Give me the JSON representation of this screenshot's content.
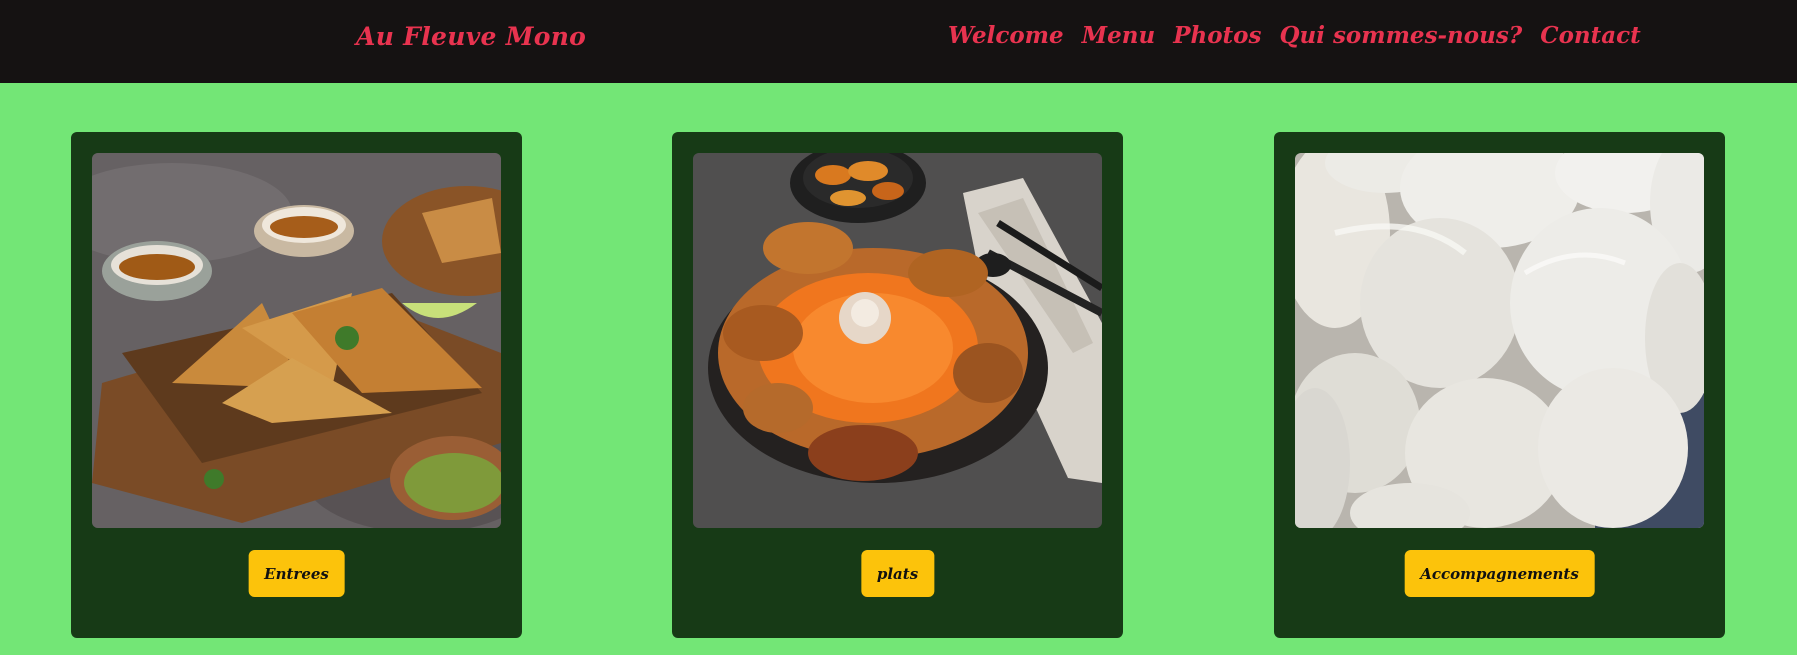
{
  "header": {
    "brand": "Au Fleuve Mono",
    "nav": [
      "Welcome",
      "Menu",
      "Photos",
      "Qui sommes-nous?",
      "Contact"
    ]
  },
  "cards": [
    {
      "button_label": "Entrees",
      "image": "samosas-photo"
    },
    {
      "button_label": "plats",
      "image": "jollof-rice-chicken-photo"
    },
    {
      "button_label": "Accompagnements",
      "image": "fufu-balls-photo"
    }
  ],
  "colors": {
    "background": "#73e676",
    "header": "#151212",
    "card": "#173a16",
    "accent_text": "#e8334f",
    "button": "#fcc30b"
  }
}
